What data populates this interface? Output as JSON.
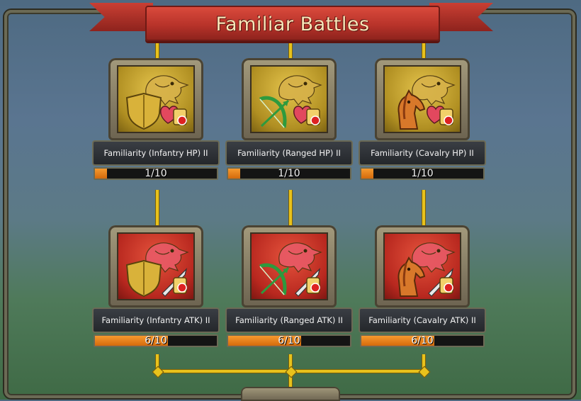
{
  "title": "Familiar Battles",
  "colors": {
    "banner": "#b8332a",
    "connector": "#e8c21c",
    "progress": "#e77f1a",
    "gold_bg": "#c9a93a",
    "red_bg": "#c8352a"
  },
  "cards": [
    {
      "label": "Familiarity (Infantry HP) II",
      "progress_text": "1/10",
      "progress": 0.1,
      "color": "gold",
      "unit_icon": "shield-icon",
      "stat_icon": "heart-icon"
    },
    {
      "label": "Familiarity (Ranged HP) II",
      "progress_text": "1/10",
      "progress": 0.1,
      "color": "gold",
      "unit_icon": "bow-icon",
      "stat_icon": "heart-icon"
    },
    {
      "label": "Familiarity (Cavalry HP) II",
      "progress_text": "1/10",
      "progress": 0.1,
      "color": "gold",
      "unit_icon": "horse-icon",
      "stat_icon": "heart-icon"
    },
    {
      "label": "Familiarity (Infantry ATK) II",
      "progress_text": "6/10",
      "progress": 0.6,
      "color": "red",
      "unit_icon": "shield-icon",
      "stat_icon": "sword-icon"
    },
    {
      "label": "Familiarity (Ranged ATK) II",
      "progress_text": "6/10",
      "progress": 0.6,
      "color": "red",
      "unit_icon": "bow-icon",
      "stat_icon": "sword-icon"
    },
    {
      "label": "Familiarity (Cavalry ATK) II",
      "progress_text": "6/10",
      "progress": 0.6,
      "color": "red",
      "unit_icon": "horse-icon",
      "stat_icon": "sword-icon"
    }
  ]
}
